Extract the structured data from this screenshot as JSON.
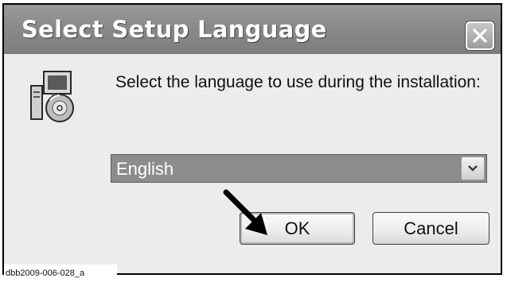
{
  "window": {
    "title": "Select Setup Language",
    "close_icon": "close-icon"
  },
  "dialog": {
    "icon": "setup-computer-disc-icon",
    "prompt": "Select the language to use during the installation:",
    "language_select": {
      "selected": "English",
      "arrow_icon": "chevron-down-icon"
    },
    "ok_label": "OK",
    "cancel_label": "Cancel",
    "pointer_icon": "arrow-pointer-icon"
  },
  "caption": "dbb2009-006-028_a"
}
